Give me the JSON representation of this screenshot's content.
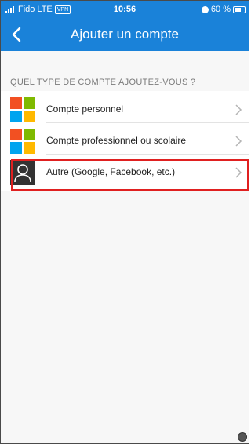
{
  "status_bar": {
    "carrier": "Fido",
    "network": "LTE",
    "vpn": "VPN",
    "time": "10:56",
    "battery": "60 %"
  },
  "header": {
    "title": "Ajouter un compte",
    "back_icon": "chevron-left-icon"
  },
  "section": {
    "heading": "QUEL TYPE DE COMPTE AJOUTEZ-VOUS ?"
  },
  "accounts": [
    {
      "label": "Compte personnel",
      "icon": "microsoft-logo-icon"
    },
    {
      "label": "Compte professionnel ou scolaire",
      "icon": "microsoft-logo-icon"
    },
    {
      "label": "Autre (Google, Facebook, etc.)",
      "icon": "person-icon"
    }
  ],
  "colors": {
    "accent": "#1a82d9",
    "highlight": "#e02020",
    "ms_red": "#f25022",
    "ms_green": "#7fba00",
    "ms_blue": "#00a4ef",
    "ms_yellow": "#ffb900"
  }
}
